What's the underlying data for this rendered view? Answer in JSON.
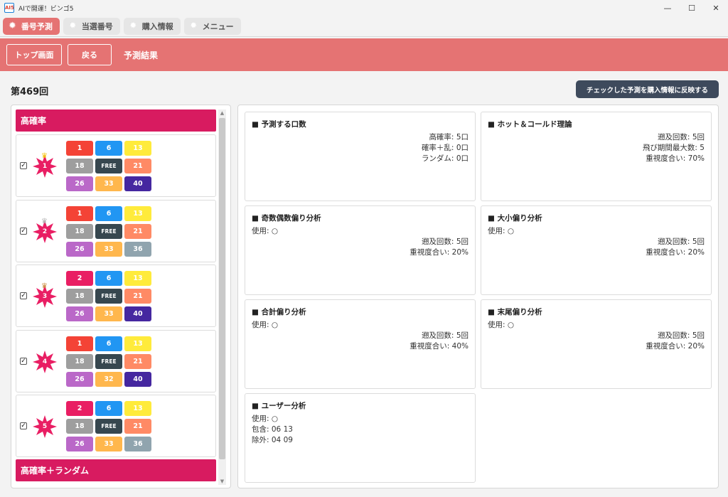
{
  "window": {
    "title": "AIで開運！ビンゴ5",
    "icon_text": "AI5"
  },
  "tabs": [
    {
      "label": "番号予測",
      "active": true
    },
    {
      "label": "当選番号",
      "active": false
    },
    {
      "label": "購入情報",
      "active": false
    },
    {
      "label": "メニュー",
      "active": false
    }
  ],
  "header": {
    "top_button": "トップ画面",
    "back_button": "戻る",
    "title": "予測結果"
  },
  "round": "第469回",
  "reflect_button": "チェックした予測を購入情報に反映する",
  "sections": {
    "high_prob": "高確率",
    "high_prob_random": "高確率＋ランダム"
  },
  "colors": {
    "accent": "#e57373",
    "section": "#d81b60",
    "red": "#f44336",
    "blue": "#2196f3",
    "yellow": "#ffeb3b",
    "gray": "#9e9e9e",
    "dark": "#37474f",
    "orange": "#ff8a65",
    "purple": "#ba68c8",
    "amber": "#ffb74d",
    "indigo": "#4527a0",
    "bluegray": "#90a4ae",
    "pink": "#e91e63"
  },
  "predictions": [
    {
      "rank": "1",
      "checked": true,
      "crown": "gold",
      "balls": [
        {
          "n": "1",
          "c": "red"
        },
        {
          "n": "6",
          "c": "blue"
        },
        {
          "n": "13",
          "c": "yellow"
        },
        {
          "n": "18",
          "c": "gray"
        },
        {
          "n": "FREE",
          "c": "dark"
        },
        {
          "n": "21",
          "c": "orange"
        },
        {
          "n": "26",
          "c": "purple"
        },
        {
          "n": "33",
          "c": "amber"
        },
        {
          "n": "40",
          "c": "indigo"
        }
      ]
    },
    {
      "rank": "2",
      "checked": true,
      "crown": "silver",
      "balls": [
        {
          "n": "1",
          "c": "red"
        },
        {
          "n": "6",
          "c": "blue"
        },
        {
          "n": "13",
          "c": "yellow"
        },
        {
          "n": "18",
          "c": "gray"
        },
        {
          "n": "FREE",
          "c": "dark"
        },
        {
          "n": "21",
          "c": "orange"
        },
        {
          "n": "26",
          "c": "purple"
        },
        {
          "n": "33",
          "c": "amber"
        },
        {
          "n": "36",
          "c": "bluegray"
        }
      ]
    },
    {
      "rank": "3",
      "checked": true,
      "crown": "bronze",
      "balls": [
        {
          "n": "2",
          "c": "pink"
        },
        {
          "n": "6",
          "c": "blue"
        },
        {
          "n": "13",
          "c": "yellow"
        },
        {
          "n": "18",
          "c": "gray"
        },
        {
          "n": "FREE",
          "c": "dark"
        },
        {
          "n": "21",
          "c": "orange"
        },
        {
          "n": "26",
          "c": "purple"
        },
        {
          "n": "33",
          "c": "amber"
        },
        {
          "n": "40",
          "c": "indigo"
        }
      ]
    },
    {
      "rank": "4",
      "checked": true,
      "crown": "",
      "balls": [
        {
          "n": "1",
          "c": "red"
        },
        {
          "n": "6",
          "c": "blue"
        },
        {
          "n": "13",
          "c": "yellow"
        },
        {
          "n": "18",
          "c": "gray"
        },
        {
          "n": "FREE",
          "c": "dark"
        },
        {
          "n": "21",
          "c": "orange"
        },
        {
          "n": "26",
          "c": "purple"
        },
        {
          "n": "32",
          "c": "amber"
        },
        {
          "n": "40",
          "c": "indigo"
        }
      ]
    },
    {
      "rank": "5",
      "checked": true,
      "crown": "",
      "balls": [
        {
          "n": "2",
          "c": "pink"
        },
        {
          "n": "6",
          "c": "blue"
        },
        {
          "n": "13",
          "c": "yellow"
        },
        {
          "n": "18",
          "c": "gray"
        },
        {
          "n": "FREE",
          "c": "dark"
        },
        {
          "n": "21",
          "c": "orange"
        },
        {
          "n": "26",
          "c": "purple"
        },
        {
          "n": "33",
          "c": "amber"
        },
        {
          "n": "36",
          "c": "bluegray"
        }
      ]
    }
  ],
  "analysis": [
    {
      "title": "予測する口数",
      "left": [],
      "right": [
        "高確率: 5口",
        "確率＋乱: 0口",
        "ランダム: 0口"
      ]
    },
    {
      "title": "ホット＆コールド理論",
      "left": [],
      "right": [
        "遡及回数: 5回",
        "飛び期間最大数: 5",
        "重視度合い: 70%"
      ]
    },
    {
      "title": "奇数偶数偏り分析",
      "left": [
        "使用: ○"
      ],
      "right": [
        "遡及回数: 5回",
        "重視度合い: 20%"
      ]
    },
    {
      "title": "大小偏り分析",
      "left": [
        "使用: ○"
      ],
      "right": [
        "遡及回数: 5回",
        "重視度合い: 20%"
      ]
    },
    {
      "title": "合計偏り分析",
      "left": [
        "使用: ○"
      ],
      "right": [
        "遡及回数: 5回",
        "重視度合い: 40%"
      ]
    },
    {
      "title": "末尾偏り分析",
      "left": [
        "使用: ○"
      ],
      "right": [
        "遡及回数: 5回",
        "重視度合い: 20%"
      ]
    },
    {
      "title": "ユーザー分析",
      "left": [
        "使用: ○",
        "包含: 06 13",
        "除外: 04 09"
      ],
      "right": []
    }
  ]
}
